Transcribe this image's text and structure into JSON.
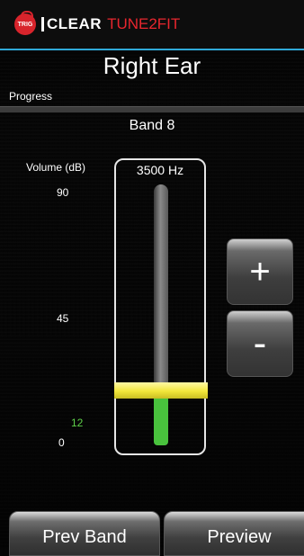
{
  "header": {
    "logo_badge": "TRIG",
    "brand_main": "CLEAR",
    "brand_product": "TUNE2FIT"
  },
  "ear_title": "Right Ear",
  "progress": {
    "label": "Progress",
    "value": 0
  },
  "band_label": "Band 8",
  "volume": {
    "label": "Volume (dB)",
    "ticks": {
      "top": "90",
      "mid": "45",
      "current": "12",
      "bottom": "0"
    },
    "current_db": 12,
    "max_db": 90
  },
  "frequency_label": "3500 Hz",
  "buttons": {
    "increase": "+",
    "decrease": "-",
    "prev_band": "Prev Band",
    "preview": "Preview"
  },
  "colors": {
    "accent_blue": "#2fa9d8",
    "brand_red": "#e8262e",
    "level_green": "#49c23d",
    "thumb_yellow": "#f1e63a"
  }
}
